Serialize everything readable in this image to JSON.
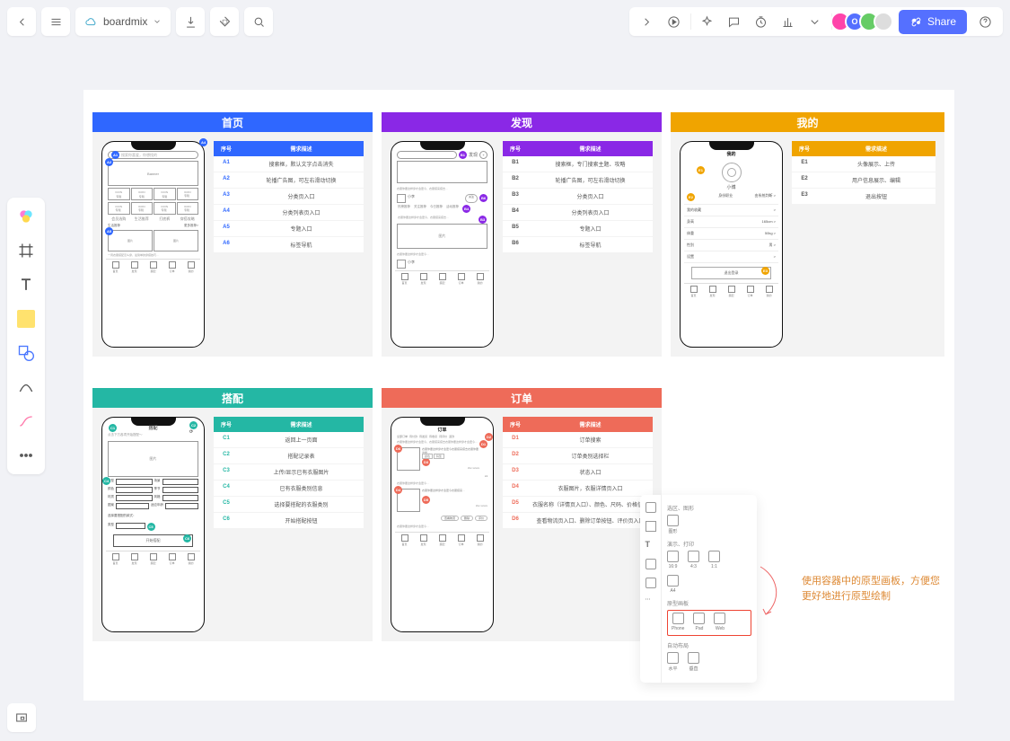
{
  "chrome": {
    "doc_name": "boardmix",
    "share_label": "Share",
    "avatar_initial": "O"
  },
  "sections": [
    {
      "id": "home",
      "title": "首页",
      "color": "blue",
      "phone_head": "首页",
      "search_placeholder": "搜索你喜爱，你想找的",
      "icons_label": "ICON",
      "blocks": [
        "Banner",
        "专辑",
        "专辑",
        "专辑",
        "会员选购",
        "生活推荐",
        "穿搭攻略",
        "图片",
        "图片"
      ],
      "tabbar": [
        "首页",
        "发现",
        "搭配",
        "订单",
        "我的"
      ],
      "req_head": [
        "序号",
        "需求描述"
      ],
      "reqs": [
        [
          "A1",
          "搜索框，默认文字点击消失"
        ],
        [
          "A2",
          "轮播广告图，可左右滑动切换"
        ],
        [
          "A3",
          "分类页入口"
        ],
        [
          "A4",
          "分类列表页入口"
        ],
        [
          "A5",
          "专题入口"
        ],
        [
          "A6",
          "标签导航"
        ]
      ]
    },
    {
      "id": "discover",
      "title": "发现",
      "color": "purple",
      "phone_head": "发现",
      "blocks": [
        "",
        "图片"
      ],
      "tabbar": [
        "首页",
        "发现",
        "搭配",
        "订单",
        "我的"
      ],
      "req_head": [
        "序号",
        "需求描述"
      ],
      "reqs": [
        [
          "B1",
          "搜索框，专门搜索主题、攻略"
        ],
        [
          "B2",
          "轮播广告图，可左右滑动切换"
        ],
        [
          "B3",
          "分类页入口"
        ],
        [
          "B4",
          "分类列表页入口"
        ],
        [
          "B5",
          "专题入口"
        ],
        [
          "B6",
          "标签导航"
        ]
      ]
    },
    {
      "id": "mine",
      "title": "我的",
      "color": "gold",
      "phone_head": "我的",
      "user": "小博",
      "list": [
        [
          "身份职业",
          "由系统判断 >"
        ],
        [
          "我的收藏",
          ">"
        ],
        [
          "身高",
          "165cm >"
        ],
        [
          "体重",
          "50kg >"
        ],
        [
          "性别",
          "男 >"
        ],
        [
          "设置",
          ">"
        ]
      ],
      "logout": "退出登录",
      "tabbar": [
        "首页",
        "发现",
        "搭配",
        "订单",
        "我的"
      ],
      "req_head": [
        "序号",
        "需求描述"
      ],
      "reqs": [
        [
          "E1",
          "头像展示、上传"
        ],
        [
          "E2",
          "用户信息展示、编辑"
        ],
        [
          "E3",
          "退出按钮"
        ]
      ]
    },
    {
      "id": "combo",
      "title": "搭配",
      "color": "teal",
      "phone_head": "搭配",
      "top_hint": "点击下方各项开始搭配～",
      "block_label": "图片",
      "fields": [
        [
          "类型",
          "▾",
          "场景",
          "▾"
        ],
        [
          "颜色",
          "▾",
          "季节",
          "▾"
        ],
        [
          "材质",
          "▾",
          "风格",
          "▾"
        ],
        [
          "图案",
          "▾",
          "适应年龄",
          "▾"
        ]
      ],
      "extra": [
        "类型",
        "▾"
      ],
      "action": "开始搭配",
      "tabbar": [
        "首页",
        "发现",
        "搭配",
        "订单",
        "我的"
      ],
      "req_head": [
        "序号",
        "需求描述"
      ],
      "reqs": [
        [
          "C1",
          "返回上一页面"
        ],
        [
          "C2",
          "搭配记录表"
        ],
        [
          "C3",
          "上传/显示已有衣服图片"
        ],
        [
          "C4",
          "已有衣服类别信息"
        ],
        [
          "C5",
          "选择要搭配的衣服类别"
        ],
        [
          "C6",
          "开始搭配按钮"
        ]
      ]
    },
    {
      "id": "order",
      "title": "订单",
      "color": "coral",
      "phone_head": "订单",
      "tabs": [
        "全部订单",
        "待付款",
        "待发货",
        "待收货",
        "待评价",
        "退款"
      ],
      "order_status": "待付款",
      "price": "¥xx xxxxx",
      "tabbar": [
        "首页",
        "发现",
        "搭配",
        "订单",
        "我的"
      ],
      "req_head": [
        "序号",
        "需求描述"
      ],
      "reqs": [
        [
          "D1",
          "订单搜索"
        ],
        [
          "D2",
          "订单类别选择栏"
        ],
        [
          "D3",
          "状态入口"
        ],
        [
          "D4",
          "衣服图片，衣服详情页入口"
        ],
        [
          "D5",
          "衣服名称（详情页入口）、颜色、尺码、价格信息"
        ],
        [
          "D6",
          "查看物流页入口、删除订单按钮、评价页入口"
        ]
      ]
    }
  ],
  "panel": {
    "group1_label": "选区、图形",
    "group1_item": "图形",
    "group2_label": "演示、打印",
    "group2_items": [
      "16:9",
      "4:3",
      "1:1",
      "A4"
    ],
    "group3_label": "原型画板",
    "group3_items": [
      "Phone",
      "Pad",
      "Web"
    ],
    "group4_label": "自动布局",
    "group4_items": [
      "水平",
      "垂直"
    ]
  },
  "instruction": "使用容器中的原型画板，方便您更好地进行原型绘制"
}
